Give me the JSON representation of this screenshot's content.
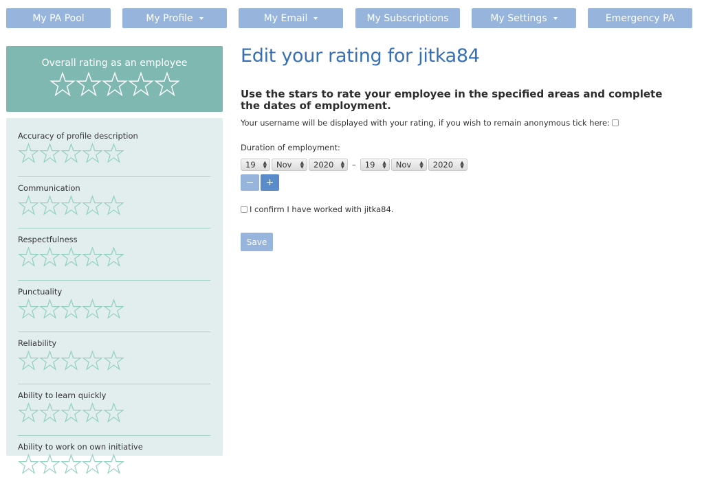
{
  "nav": {
    "items": [
      {
        "label": "My PA Pool",
        "dropdown": false
      },
      {
        "label": "My Profile",
        "dropdown": true
      },
      {
        "label": "My Email",
        "dropdown": true
      },
      {
        "label": "My Subscriptions",
        "dropdown": false
      },
      {
        "label": "My Settings",
        "dropdown": true
      },
      {
        "label": "Emergency PA",
        "dropdown": false
      }
    ]
  },
  "sidebar": {
    "overall_title": "Overall rating as an employee",
    "overall_rating": 0,
    "max_stars": 5,
    "criteria": [
      {
        "label": "Accuracy of profile description",
        "rating": 0
      },
      {
        "label": "Communication",
        "rating": 0
      },
      {
        "label": "Respectfulness",
        "rating": 0
      },
      {
        "label": "Punctuality",
        "rating": 0
      },
      {
        "label": "Reliability",
        "rating": 0
      },
      {
        "label": "Ability to learn quickly",
        "rating": 0
      },
      {
        "label": "Ability to work on own initiative",
        "rating": 0
      }
    ]
  },
  "main": {
    "title": "Edit your rating for jitka84",
    "instructions": "Use the stars to rate your employee in the specified areas and complete the dates of employment.",
    "anonymous_text": "Your username will be displayed with your rating, if you wish to remain anonymous tick here:",
    "anonymous_checked": false,
    "duration_label": "Duration of employment:",
    "start_date": {
      "day": "19",
      "month": "Nov",
      "year": "2020"
    },
    "separator": "–",
    "end_date": {
      "day": "19",
      "month": "Nov",
      "year": "2020"
    },
    "minus_label": "−",
    "plus_label": "+",
    "confirm_text": "I confirm I have worked with jitka84.",
    "confirm_checked": false,
    "save_label": "Save"
  },
  "colors": {
    "nav_button": "#97b5dc",
    "overall_bg": "#7fb8b0",
    "criteria_bg": "#e2eeee",
    "star_outline": "#8fcfbf",
    "title": "#3770b5",
    "minus_disabled": "#97b5dc",
    "plus_active": "#5a8ccc"
  }
}
